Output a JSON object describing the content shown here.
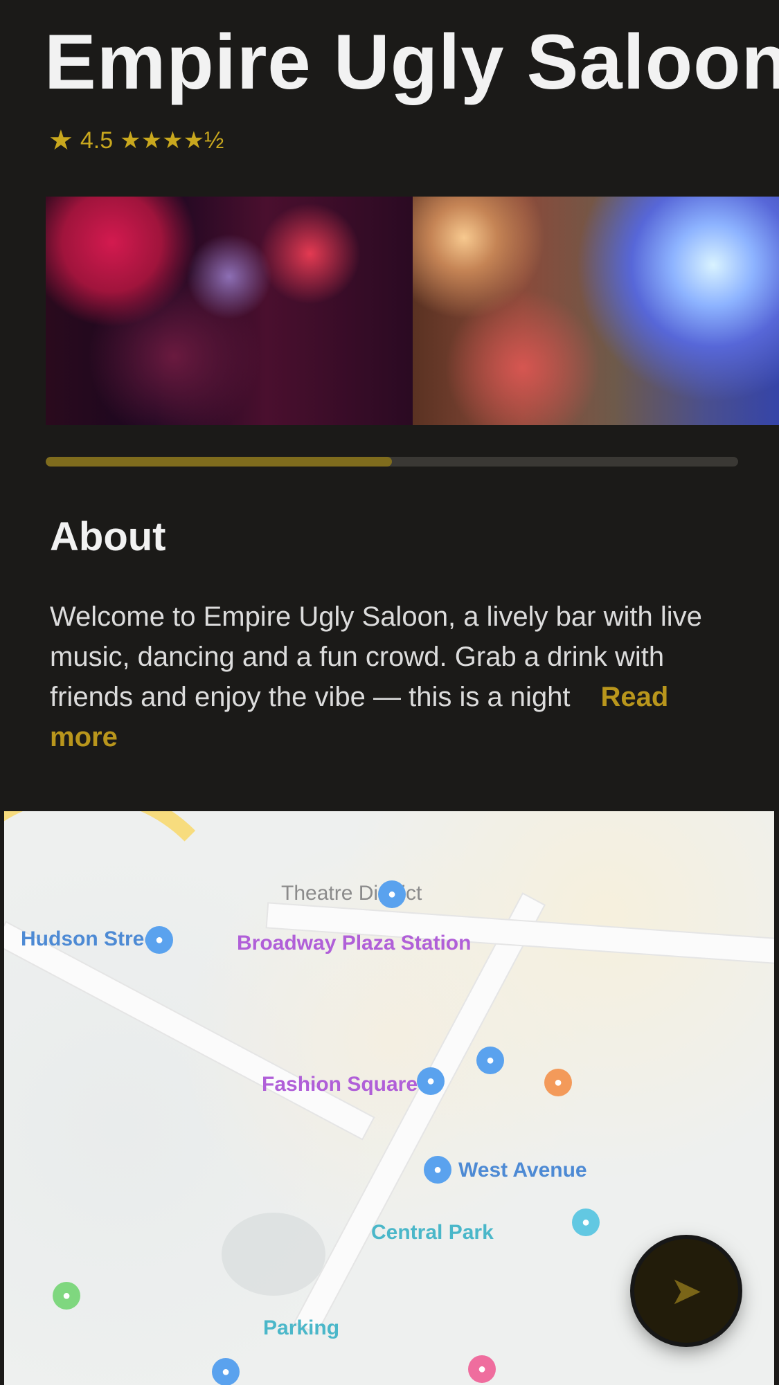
{
  "venue": {
    "title": "Empire Ugly Saloon",
    "rating_value": "4.5",
    "rating_stars": "★★★★½"
  },
  "gallery": {
    "progress": 0.5
  },
  "about": {
    "heading": "About",
    "text": "Welcome to Empire Ugly Saloon, a lively bar with live music, dancing and a fun crowd. Grab a drink with friends and enjoy the vibe — this is a night",
    "read_more": "Read more"
  },
  "map": {
    "labels": [
      "Theatre District",
      "Broadway Plaza Station",
      "Fashion Square",
      "Central Park",
      "Hudson Street",
      "West Avenue",
      "Parking"
    ]
  },
  "fab": {
    "icon": "directions-icon",
    "glyph": "➤"
  },
  "colors": {
    "accent": "#c9a81e",
    "background": "#1b1a18"
  }
}
